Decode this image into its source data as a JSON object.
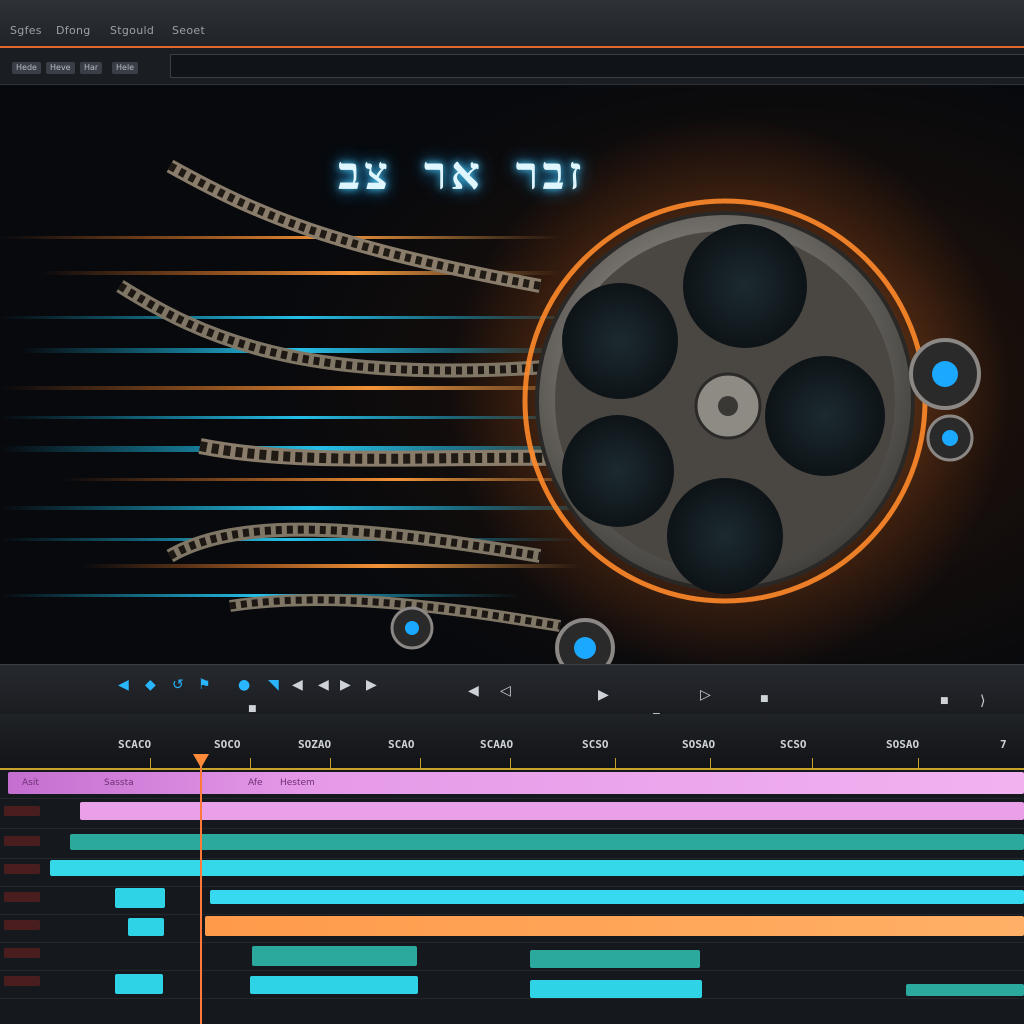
{
  "menubar": {
    "items": [
      {
        "label": "Sgfes"
      },
      {
        "label": "Dfong"
      },
      {
        "label": "Stgould"
      },
      {
        "label": "Seoet"
      }
    ]
  },
  "toolbar": {
    "buttons": [
      {
        "label": "Hede"
      },
      {
        "label": "Heve"
      },
      {
        "label": "Har"
      },
      {
        "label": "Hele"
      }
    ],
    "field_value": ""
  },
  "preview": {
    "title_text": "זבר אר צב"
  },
  "transport": {
    "controls": [
      {
        "icon": "play-icon"
      },
      {
        "icon": "stop-icon"
      },
      {
        "icon": "step-back-icon"
      },
      {
        "icon": "step-forward-icon"
      },
      {
        "icon": "skip-end-icon"
      }
    ]
  },
  "timeline": {
    "ruler_labels": [
      "SCACO",
      "SOCO",
      "SOZAO",
      "SCAO",
      "SCAAO",
      "SCSO",
      "SOSAO",
      "SCSO",
      "SOSAO",
      "7"
    ],
    "clip_labels": [
      "Asit",
      "Sassta",
      "Afe",
      "Hestem"
    ],
    "colors": {
      "magenta_track": "#e59ae8",
      "cyan_track": "#2fd3e6",
      "teal_track": "#2aa99c",
      "orange_track": "#ff9a4a",
      "playhead": "#ff7a3a",
      "accent_orange": "#e0662b",
      "ruler_underline": "#c9a229"
    }
  }
}
